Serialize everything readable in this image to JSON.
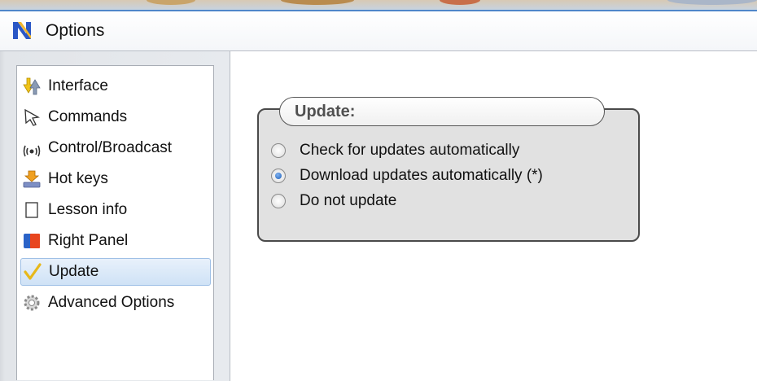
{
  "window": {
    "title": "Options"
  },
  "sidebar": {
    "items": [
      {
        "label": "Interface",
        "icon": "arrows-icon"
      },
      {
        "label": "Commands",
        "icon": "cursor-icon"
      },
      {
        "label": "Control/Broadcast",
        "icon": "broadcast-icon"
      },
      {
        "label": "Hot keys",
        "icon": "hotkey-icon"
      },
      {
        "label": "Lesson info",
        "icon": "page-icon"
      },
      {
        "label": "Right Panel",
        "icon": "panel-icon"
      },
      {
        "label": "Update",
        "icon": "checkmark-icon",
        "selected": true
      },
      {
        "label": "Advanced Options",
        "icon": "gear-icon"
      }
    ]
  },
  "update": {
    "group_title": "Update:",
    "options": [
      {
        "label": "Check for updates automatically",
        "checked": false
      },
      {
        "label": "Download updates automatically (*)",
        "checked": true
      },
      {
        "label": "Do not update",
        "checked": false
      }
    ]
  },
  "colors": {
    "selection_bg": "#cfe2f6",
    "selection_border": "#9fc0e6",
    "group_bg": "#e1e1e1",
    "radio_checked": "#1f5fb8"
  }
}
